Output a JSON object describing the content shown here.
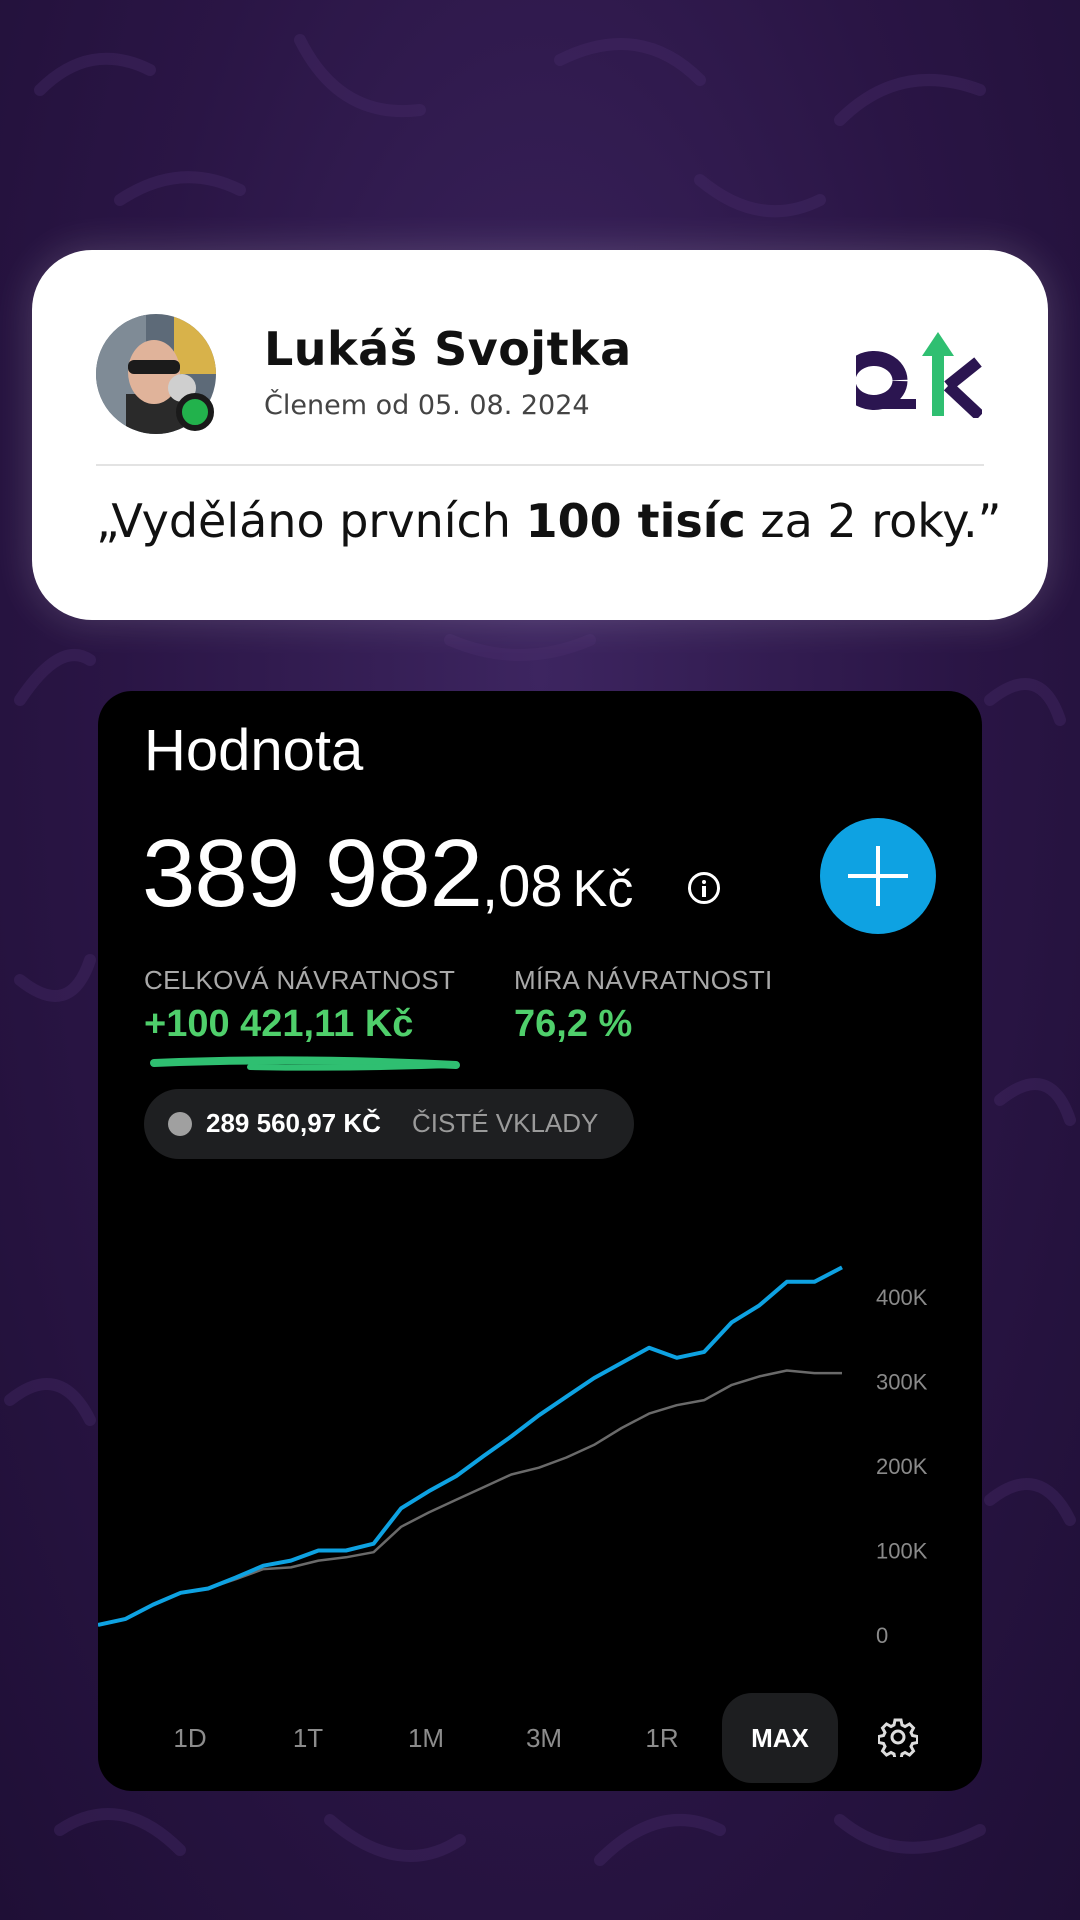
{
  "testimonial": {
    "name": "Lukáš Svojtka",
    "member_since": "Členem od 05. 08. 2024",
    "quote_prefix": "„Vyděláno prvních ",
    "quote_bold": "100 tisíc",
    "quote_suffix": " za 2 roky.”"
  },
  "portfolio": {
    "title": "Hodnota",
    "value_integer": "389 982",
    "value_decimal": ",08",
    "currency": "Kč",
    "stats": [
      {
        "label": "CELKOVÁ NÁVRATNOST",
        "value": "+100 421,11 Kč"
      },
      {
        "label": "MÍRA NÁVRATNOSTI",
        "value": "76,2 %"
      }
    ],
    "deposits_amount": "289 560,97 KČ",
    "deposits_label": "ČISTÉ VKLADY",
    "ranges": [
      "1D",
      "1T",
      "1M",
      "3M",
      "1R",
      "MAX"
    ],
    "active_range": "MAX"
  },
  "colors": {
    "accent_blue": "#0ea2e2",
    "positive_green": "#4fcf6b",
    "brand_purple": "#2b1550",
    "brand_green": "#2fbf71"
  },
  "chart_data": {
    "type": "line",
    "y_ticks": [
      "400K",
      "300K",
      "200K",
      "100K",
      "0"
    ],
    "ylim": [
      0,
      400000
    ],
    "grid": false,
    "series": [
      {
        "values": [
          12000,
          19000,
          36000,
          50000,
          55000,
          68000,
          82000,
          88000,
          100000,
          100000,
          108000,
          150000,
          170000,
          188000,
          212000,
          235000,
          260000,
          282000,
          304000,
          322000,
          340000,
          328000,
          335000,
          370000,
          390000,
          418000,
          418000,
          435000
        ]
      },
      {
        "values": [
          12000,
          19000,
          36000,
          50000,
          55000,
          66000,
          78000,
          80000,
          88000,
          92000,
          98000,
          128000,
          145000,
          160000,
          175000,
          190000,
          198000,
          210000,
          225000,
          245000,
          262000,
          272000,
          278000,
          296000,
          306000,
          313000,
          310000,
          310000
        ]
      }
    ]
  }
}
